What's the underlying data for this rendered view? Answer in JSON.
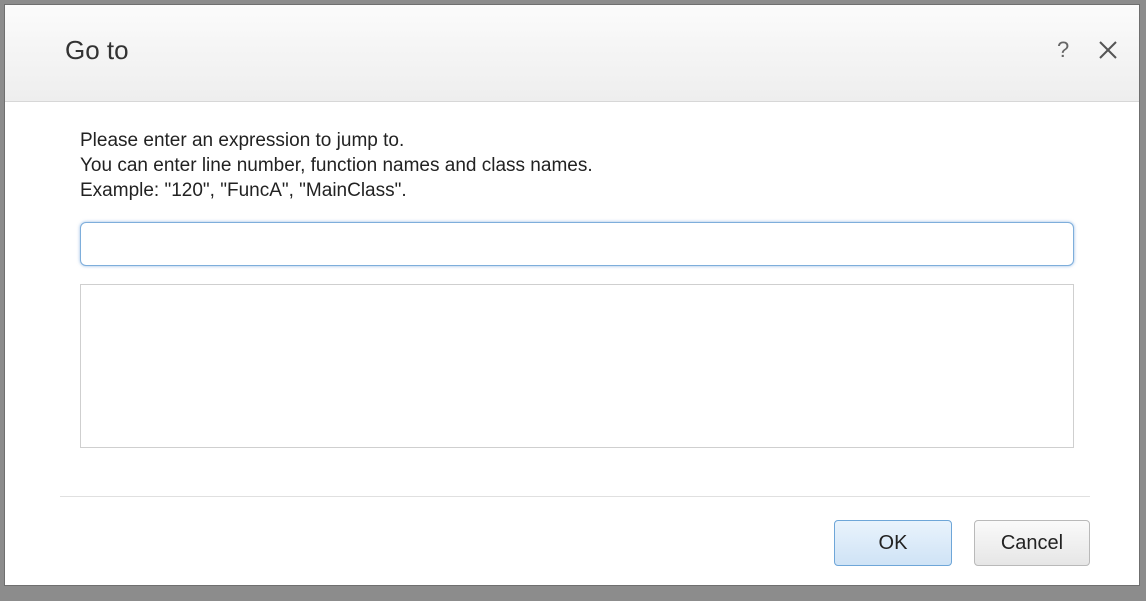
{
  "dialog": {
    "title": "Go to",
    "help_glyph": "?",
    "help_icon": "help-icon",
    "close_icon": "close-icon",
    "instructions": [
      "Please enter an expression to jump to.",
      "You can enter line number, function names and class names.",
      "Example: \"120\", \"FuncA\", \"MainClass\"."
    ],
    "expression_input": {
      "value": "",
      "placeholder": ""
    },
    "buttons": {
      "ok_label": "OK",
      "cancel_label": "Cancel"
    },
    "colors": {
      "primary_button_border": "#6ea6d8",
      "input_focus_border": "#7eaedb"
    }
  }
}
